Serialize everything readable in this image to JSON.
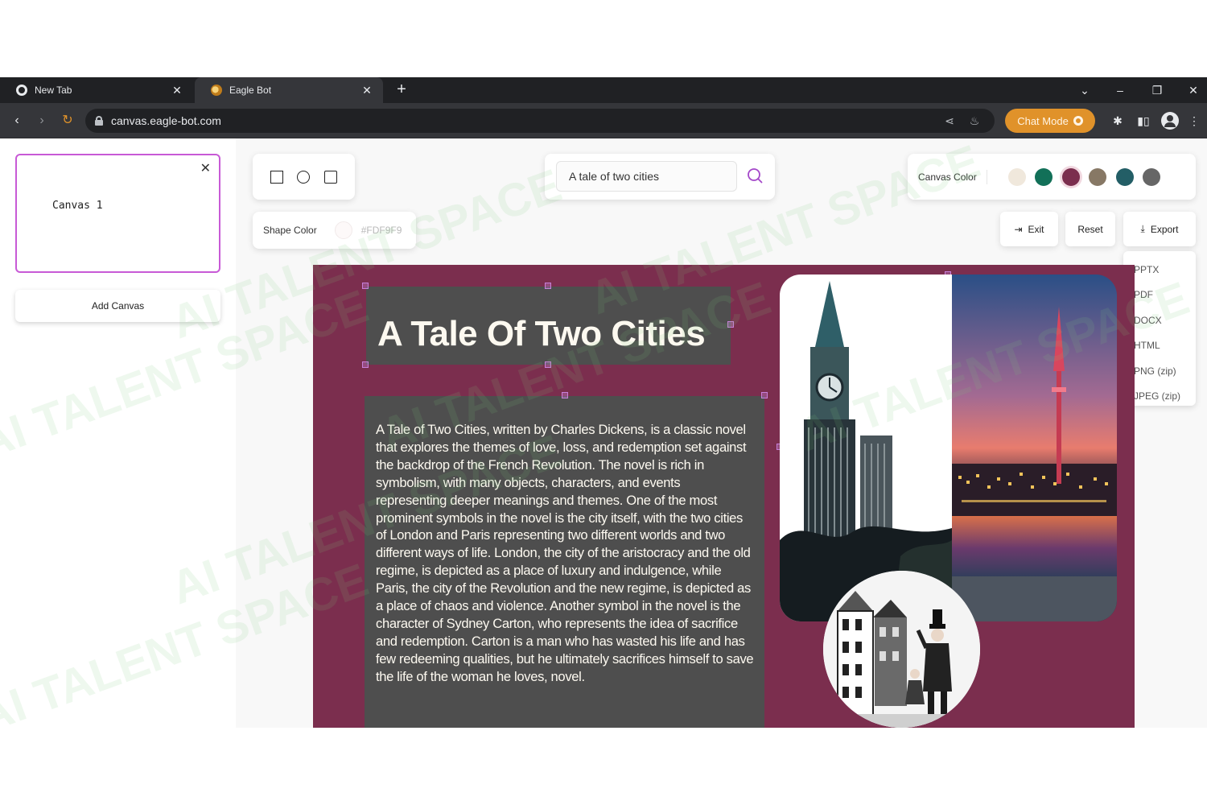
{
  "browser": {
    "tabs": [
      {
        "title": "New Tab",
        "active": false
      },
      {
        "title": "Eagle Bot",
        "active": true
      }
    ],
    "url": "canvas.eagle-bot.com",
    "chat_mode_label": "Chat Mode"
  },
  "sidebar": {
    "canvases": [
      {
        "title": "Canvas 1",
        "selected": true
      }
    ],
    "add_canvas_label": "Add Canvas"
  },
  "toolbar": {
    "shape_color_label": "Shape Color",
    "shape_color_value": "#FDF9F9",
    "search_value": "A tale of two cities",
    "canvas_color_label": "Canvas Color",
    "canvas_colors": [
      "#f0e8dc",
      "#127058",
      "#7b2e4e",
      "#877865",
      "#235e66",
      "#666666"
    ],
    "selected_canvas_color": "#7b2e4e",
    "exit_label": "Exit",
    "reset_label": "Reset",
    "export_label": "Export",
    "export_options": [
      "PPTX",
      "PDF",
      "DOCX",
      "HTML",
      "PNG (zip)",
      "JPEG (zip)"
    ]
  },
  "slide": {
    "title": "A Tale Of Two Cities",
    "body": "A Tale of Two Cities, written by Charles Dickens, is a classic novel that explores the themes of love, loss, and redemption set against the backdrop of the French Revolution. The novel is rich in symbolism, with many objects, characters, and events representing deeper meanings and themes. One of the most prominent symbols in the novel is the city itself, with the two cities of London and Paris representing two different worlds and two different ways of life. London, the city of the aristocracy and the old regime, is depicted as a place of luxury and indulgence, while Paris, the city of the Revolution and the new regime, is depicted as a place of chaos and violence. Another symbol in the novel is the character of Sydney Carton, who represents the idea of sacrifice and redemption. Carton is a man who has wasted his life and has few redeeming qualities, but he ultimately sacrifices himself to save the life of the woman he loves, novel."
  },
  "watermark": "AI TALENT SPACE"
}
